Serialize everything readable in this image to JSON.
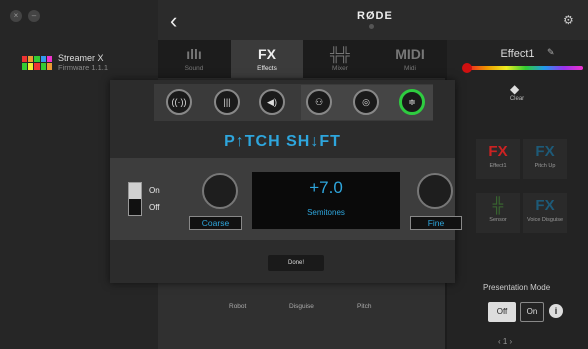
{
  "window": {
    "close_glyph": "×",
    "minimize_glyph": "–"
  },
  "device": {
    "name": "Streamer X",
    "firmware": "Firmware 1.1.1"
  },
  "header": {
    "back_glyph": "‹",
    "brand": "RØDE",
    "settings_icon": "gear-icon"
  },
  "tabs": [
    {
      "label": "Sound",
      "icon": "waveform-icon",
      "glyph": "ıllı"
    },
    {
      "label": "Effects",
      "icon": "fx-icon",
      "glyph": "FX"
    },
    {
      "label": "Mixer",
      "icon": "mixer-icon",
      "glyph": "╬╬"
    },
    {
      "label": "Midi",
      "icon": "midi-icon",
      "glyph": "MIDI"
    }
  ],
  "right_panel": {
    "effect_name": "Effect1",
    "clear_label": "Clear",
    "fx_tiles": [
      {
        "glyph": "FX",
        "label": "Effect1"
      },
      {
        "glyph": "FX",
        "label": "Pitch Up"
      },
      {
        "glyph": "╬",
        "label": "Sensor"
      },
      {
        "glyph": "FX",
        "label": "Voice Disguise"
      }
    ],
    "presentation_mode": {
      "title": "Presentation Mode",
      "off": "Off",
      "on": "On"
    },
    "pager": "‹  1  ›"
  },
  "background_labels": [
    "Robot",
    "Disguise",
    "Pitch"
  ],
  "modal": {
    "icons": [
      "echo-icon",
      "reverb-icon",
      "megaphone-icon",
      "robot-icon",
      "disguise-icon",
      "pitch-icon"
    ],
    "title": "P↑TCH SH↓FT",
    "toggle": {
      "on": "On",
      "off": "Off"
    },
    "coarse_label": "Coarse",
    "fine_label": "Fine",
    "value": "+7.0",
    "unit": "Semitones",
    "done": "Done!"
  },
  "colors": {
    "accent": "#2ea6dd",
    "selected": "#2ecc40",
    "record": "#d01010"
  }
}
